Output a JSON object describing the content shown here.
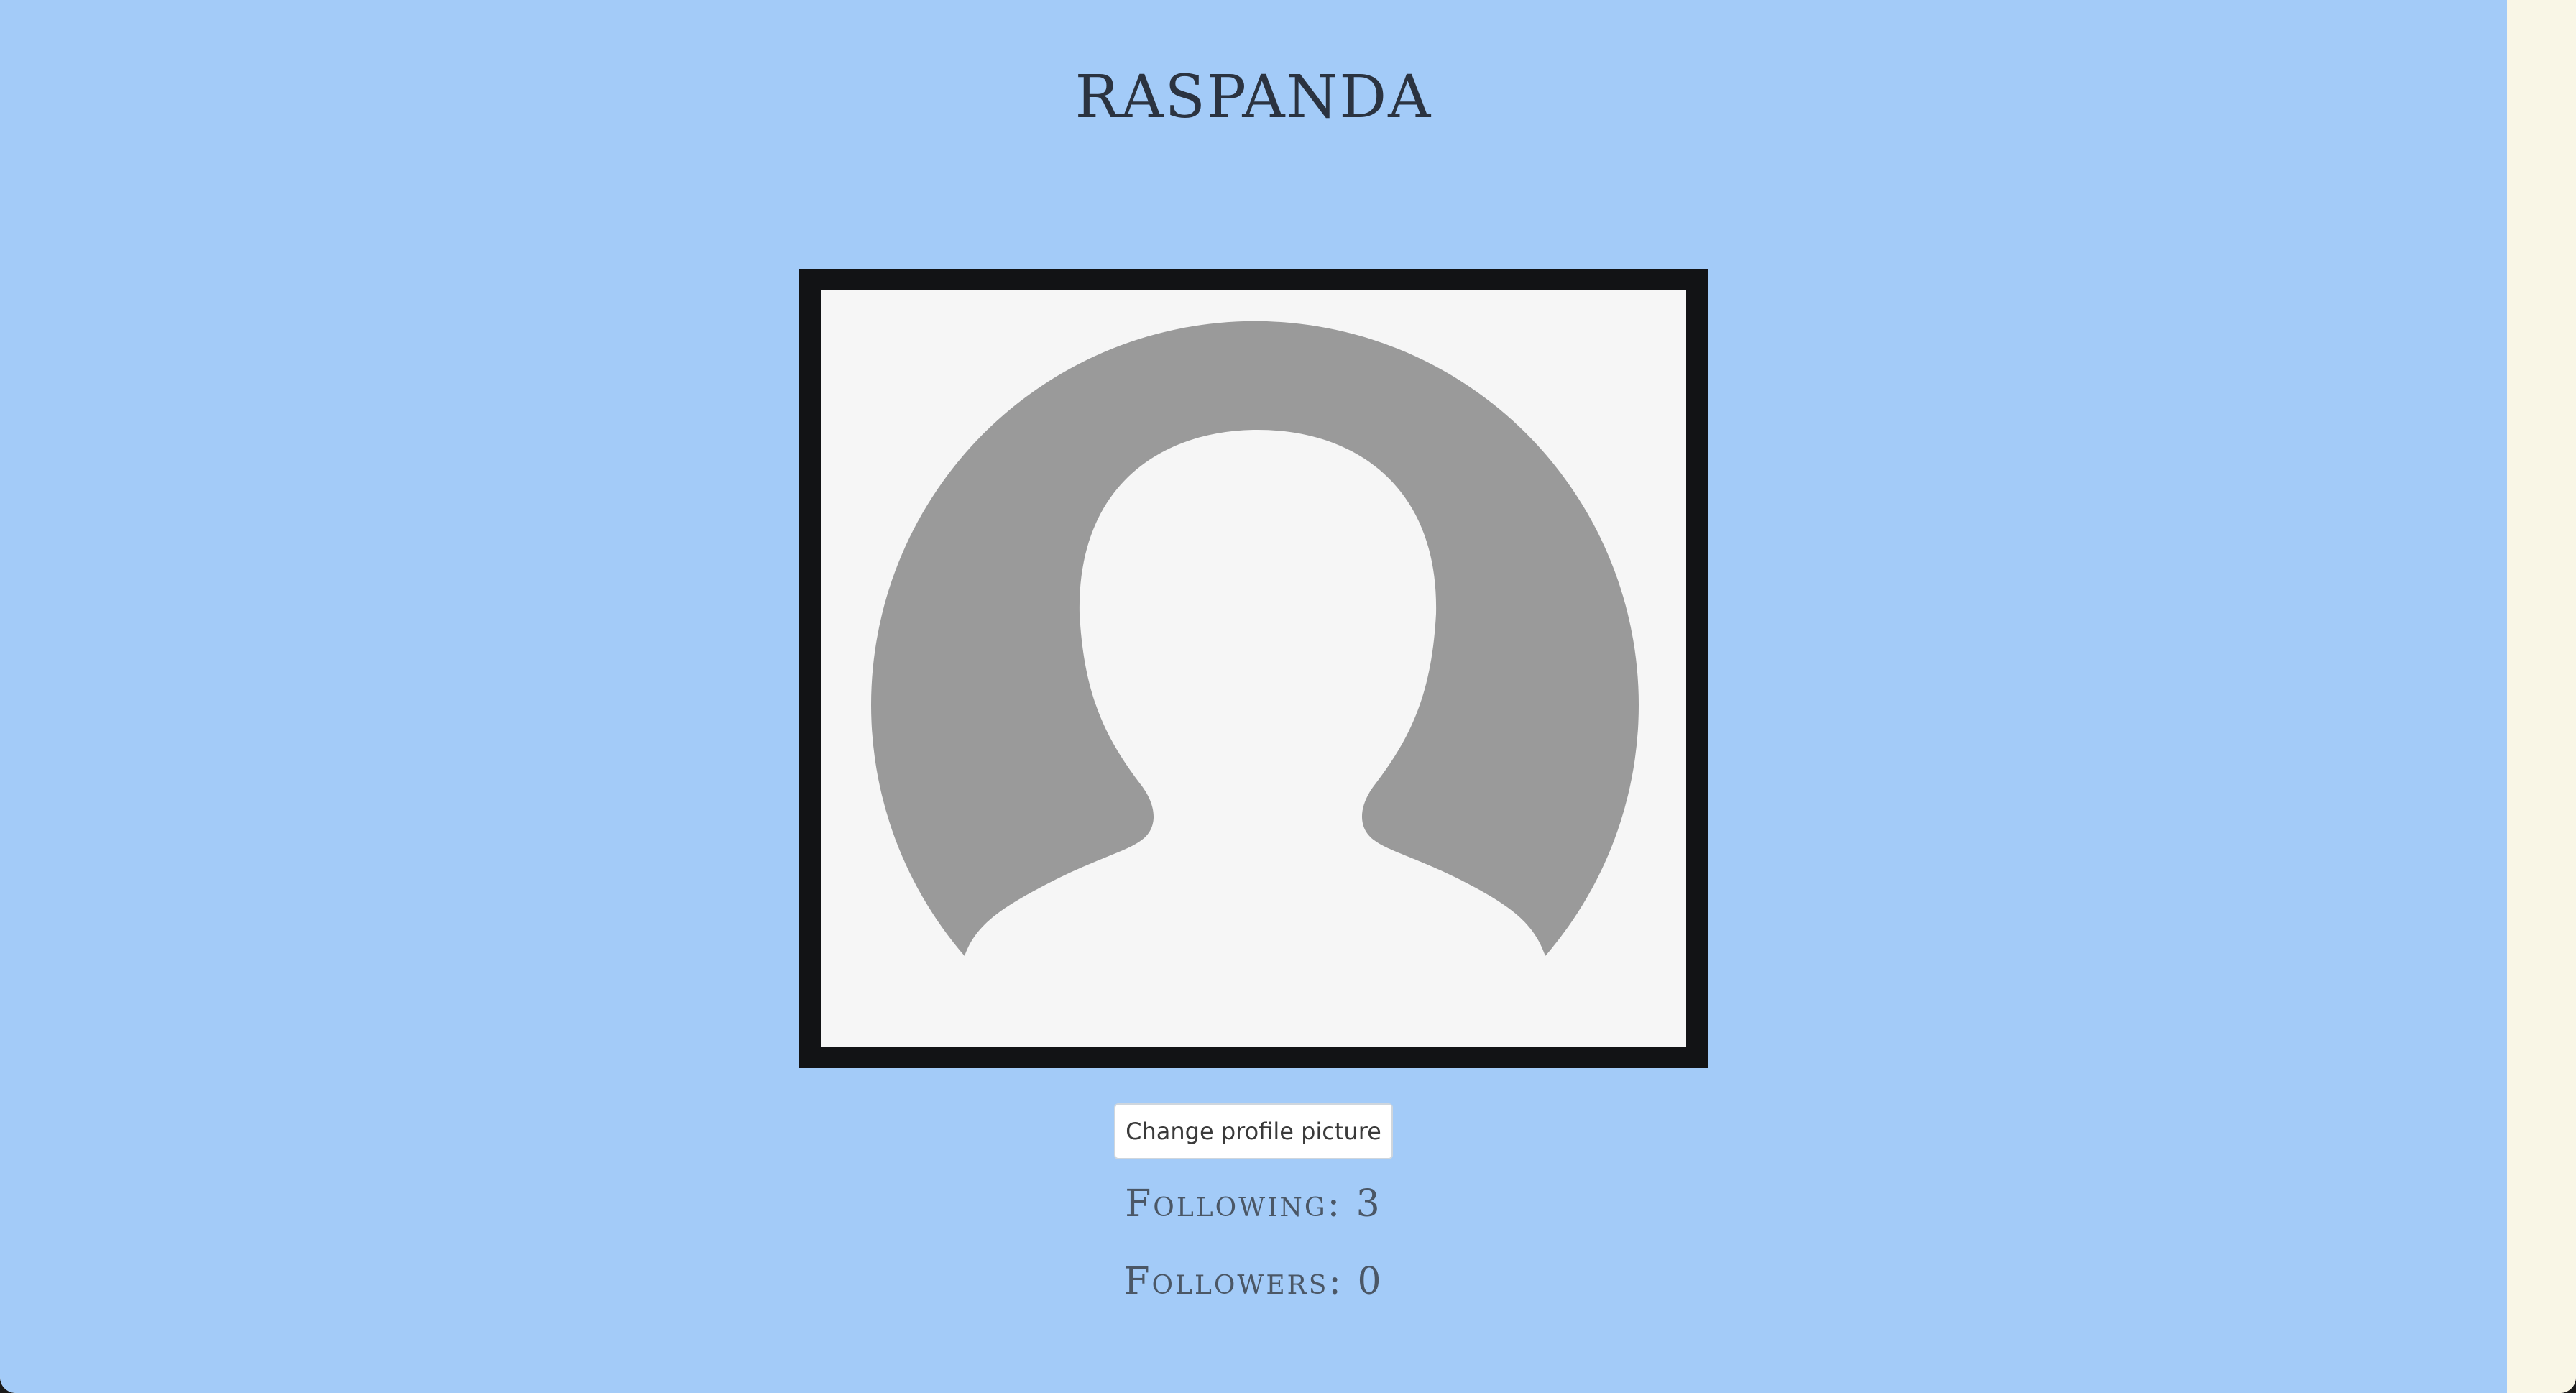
{
  "profile": {
    "username": "RASPANDA",
    "change_picture_label": "Change profile picture",
    "following_label": "Following:",
    "following_count": "3",
    "followers_label": "Followers:",
    "followers_count": "0"
  },
  "colors": {
    "background": "#a3cbf8",
    "side_panel": "#f9f6e6",
    "frame_border": "#121315",
    "avatar_silhouette": "#9a9a9a",
    "avatar_background": "#f6f6f6"
  },
  "icons": {
    "avatar": "default-user-silhouette"
  }
}
